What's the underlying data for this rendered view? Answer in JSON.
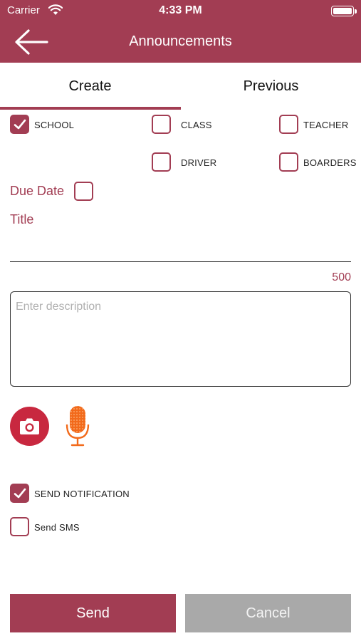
{
  "status_bar": {
    "carrier": "Carrier",
    "time": "4:33 PM"
  },
  "nav": {
    "title": "Announcements",
    "back_icon": "arrow-left-icon"
  },
  "tabs": [
    {
      "label": "Create",
      "active": true
    },
    {
      "label": "Previous",
      "active": false
    }
  ],
  "audience": {
    "school": {
      "label": "SCHOOL",
      "checked": true
    },
    "class": {
      "label": "CLASS",
      "checked": false
    },
    "teacher": {
      "label": "TEACHER",
      "checked": false
    },
    "driver": {
      "label": "DRIVER",
      "checked": false
    },
    "boarders": {
      "label": "BOARDERS",
      "checked": false
    }
  },
  "form": {
    "due_date_label": "Due Date",
    "due_date_checked": false,
    "title_label": "Title",
    "title_value": "",
    "char_count": "500",
    "description_placeholder": "Enter description",
    "description_value": ""
  },
  "media": {
    "camera_icon": "camera-icon",
    "mic_icon": "microphone-icon"
  },
  "options": {
    "send_notification": {
      "label": "SEND NOTIFICATION",
      "checked": true
    },
    "send_sms": {
      "label": "Send SMS",
      "checked": false
    }
  },
  "actions": {
    "send_label": "Send",
    "cancel_label": "Cancel"
  },
  "colors": {
    "brand": "#a23d53",
    "camera": "#c8283f",
    "mic": "#f26a1b",
    "cancel": "#a9a9a9"
  }
}
